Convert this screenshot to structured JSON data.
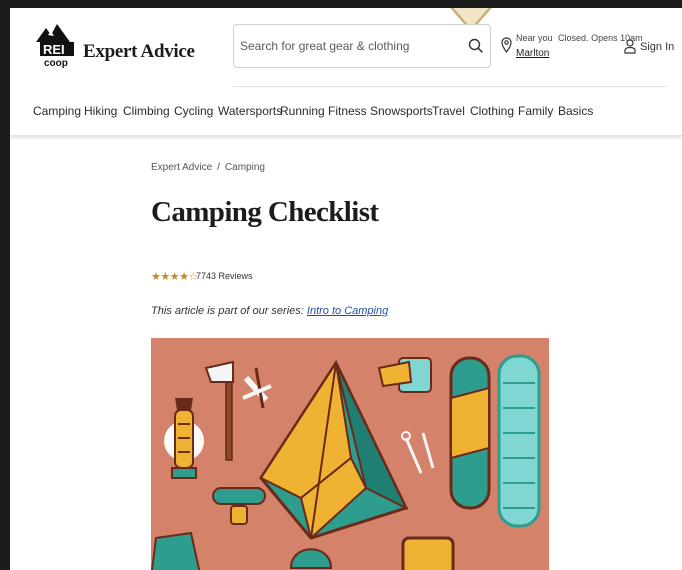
{
  "header": {
    "brand_title": "Expert Advice",
    "logo_text_top": "REI",
    "logo_text_bottom": "coop",
    "search": {
      "placeholder": "Search for great gear & clothing",
      "value": ""
    },
    "location": {
      "near_label": "Near you",
      "status": "Closed. Opens 10am",
      "store": "Marlton"
    },
    "signin_label": "Sign In"
  },
  "nav": {
    "items": [
      {
        "label": "Camping"
      },
      {
        "label": "Hiking"
      },
      {
        "label": "Climbing"
      },
      {
        "label": "Cycling"
      },
      {
        "label": "Watersports"
      },
      {
        "label": "Running"
      },
      {
        "label": "Fitness"
      },
      {
        "label": "Snowsports"
      },
      {
        "label": "Travel"
      },
      {
        "label": "Clothing"
      },
      {
        "label": "Family"
      },
      {
        "label": "Basics"
      }
    ]
  },
  "breadcrumb": {
    "items": [
      "Expert Advice",
      "Camping"
    ],
    "separator": "/"
  },
  "article": {
    "title": "Camping Checklist",
    "rating": {
      "stars": 4.5,
      "reviews_label": "7743 Reviews"
    },
    "series_prefix": "This article is part of our series:",
    "series_link": "Intro to Camping"
  },
  "colors": {
    "hero_bg": "#d4826a",
    "tent_yellow": "#f0b233",
    "teal": "#2e9d8e",
    "brown": "#6a2a1a",
    "light_cyan": "#7fd6d2"
  },
  "icons": [
    "rei-logo",
    "search-icon",
    "location-pin-icon",
    "user-icon",
    "star-icon"
  ]
}
